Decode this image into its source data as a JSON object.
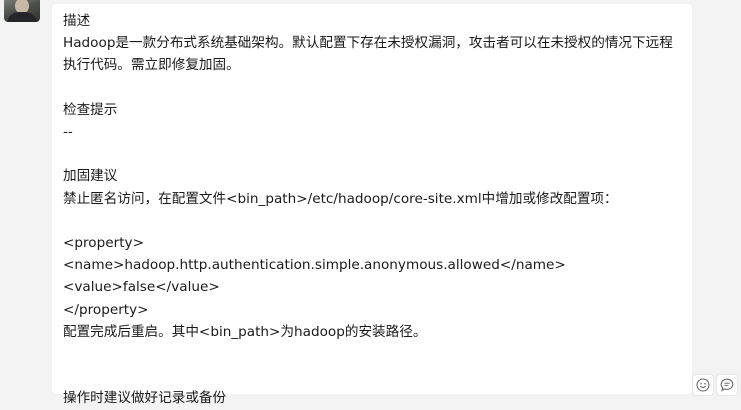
{
  "message": {
    "title": "描述",
    "description": "Hadoop是一款分布式系统基础架构。默认配置下存在未授权漏洞，攻击者可以在未授权的情况下远程执行代码。需立即修复加固。",
    "check_heading": "检查提示",
    "check_value": "--",
    "fix_heading": "加固建议",
    "fix_instruction": "禁止匿名访问，在配置文件<bin_path>/etc/hadoop/core-site.xml中增加或修改配置项：",
    "code_lines": [
      "<property>",
      "<name>hadoop.http.authentication.simple.anonymous.allowed</name>",
      "<value>false</value>",
      "</property>"
    ],
    "restart_note": "配置完成后重启。其中<bin_path>为hadoop的安装路径。",
    "backup_note": "操作时建议做好记录或备份"
  },
  "actions": {
    "emoji_icon": "smiley-icon",
    "quote_icon": "quote-icon"
  }
}
